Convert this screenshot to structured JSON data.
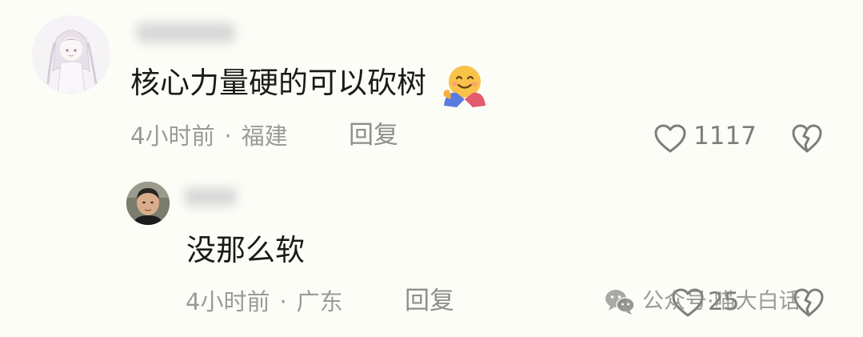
{
  "comments": [
    {
      "text": "核心力量硬的可以砍树",
      "emoji": "smiling-face-with-open-hands-emoji",
      "time": "4小时前",
      "separator": "·",
      "location": "福建",
      "reply_label": "回复",
      "likes": "1117"
    },
    {
      "text": "没那么软",
      "time": "4小时前",
      "separator": "·",
      "location": "广东",
      "reply_label": "回复",
      "likes": "25"
    }
  ],
  "watermark": {
    "text": "公众号·喵大白话",
    "icon": "wechat-icon"
  },
  "colors": {
    "background": "#fdfdf7",
    "text": "#1a1a1a",
    "meta": "#9a9a9a",
    "icon": "#7d7d7d"
  }
}
